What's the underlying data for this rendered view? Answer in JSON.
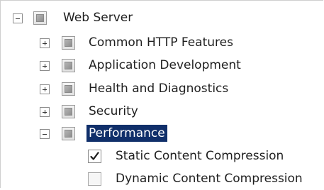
{
  "tree": {
    "root": {
      "label": "Web Server",
      "expanded": true,
      "check_state": "partial",
      "children": [
        {
          "label": "Common HTTP Features",
          "expanded": false,
          "check_state": "partial"
        },
        {
          "label": "Application Development",
          "expanded": false,
          "check_state": "partial"
        },
        {
          "label": "Health and Diagnostics",
          "expanded": false,
          "check_state": "partial"
        },
        {
          "label": "Security",
          "expanded": false,
          "check_state": "partial"
        },
        {
          "label": "Performance",
          "expanded": true,
          "selected": true,
          "check_state": "partial",
          "children": [
            {
              "label": "Static Content Compression",
              "check_state": "checked"
            },
            {
              "label": "Dynamic Content Compression",
              "check_state": "unchecked"
            }
          ]
        }
      ]
    }
  },
  "colors": {
    "selection_bg": "#102f6a",
    "selection_text": "#ffffff"
  },
  "icons": {
    "expanded": "minus-expander-icon",
    "collapsed": "plus-expander-icon",
    "check": "checkmark-icon"
  }
}
